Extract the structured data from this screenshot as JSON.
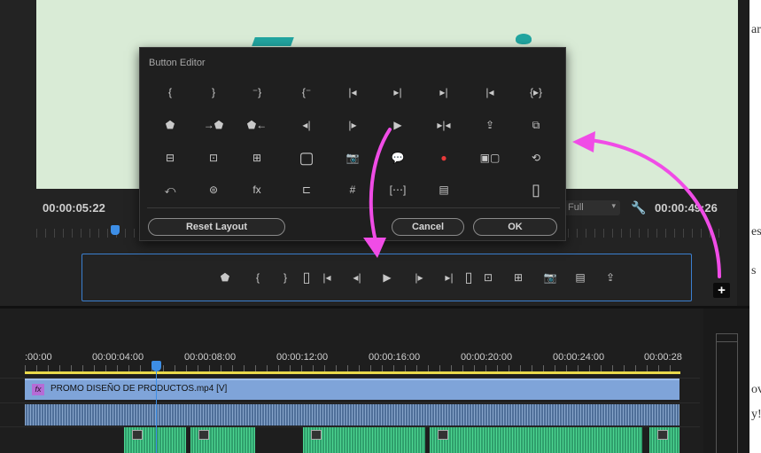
{
  "monitor": {
    "timecode_current": "00:00:05:22",
    "timecode_duration": "00:00:49:26",
    "playback_resolution": "Full"
  },
  "button_editor": {
    "title": "Button Editor",
    "reset_label": "Reset Layout",
    "cancel_label": "Cancel",
    "ok_label": "OK",
    "rows": [
      [
        "{",
        "}",
        "⁻}",
        "{⁻",
        "|◂",
        "▸|",
        "▸|",
        "|◂",
        "{▸}"
      ],
      [
        "⬟",
        "→⬟",
        "⬟←",
        "◂|",
        "|▸",
        "▶",
        "▸|◂",
        "⇪",
        "⧉"
      ],
      [
        "⊟",
        "⊡",
        "⊞",
        "▢",
        "📷",
        "💬",
        "●",
        "▣▢",
        "⟲"
      ],
      [
        "⤺",
        "⊜",
        "fx",
        "⊏",
        "#",
        "[⋯]",
        "▤",
        "",
        "▯"
      ]
    ]
  },
  "button_bar": {
    "icons": [
      "⬟",
      "{",
      "}",
      "▯",
      "|◂",
      "◂|",
      "▶",
      "|▸",
      "▸|",
      "▯",
      "⊡",
      "⊞",
      "📷",
      "▤",
      "⇪"
    ]
  },
  "add_button_label": "+",
  "timeline": {
    "ruler_labels": [
      ":00:00",
      "00:00:04:00",
      "00:00:08:00",
      "00:00:12:00",
      "00:00:16:00",
      "00:00:20:00",
      "00:00:24:00",
      "00:00:28"
    ],
    "video_clip_label": "PROMO DISEÑO DE PRODUCTOS.mp4 [V]",
    "fx_label": "fx"
  },
  "right_strip": {
    "fragments": [
      "ar",
      "es",
      "s",
      "ov",
      "y!"
    ]
  },
  "colors": {
    "accent_blue": "#3d8ee6",
    "arrow_magenta": "#f04ce6",
    "record_red": "#e83a3a",
    "video_clip": "#7fa4d9",
    "audio_green": "#2f9f6c"
  }
}
